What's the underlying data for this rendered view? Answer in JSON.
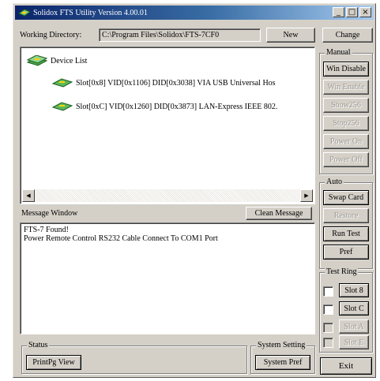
{
  "window": {
    "title": "Solidox FTS Utility Version 4.00.01",
    "controls": {
      "minimize": "_",
      "maximize": "□",
      "close": "×"
    }
  },
  "working_dir": {
    "label": "Working Directory:",
    "value": "C:\\Program Files\\Solidox\\FTS-7CF0",
    "new_label": "New",
    "change_label": "Change"
  },
  "device_tree": {
    "root": "Device List",
    "items": [
      "Slot[0x8] VID[0x1106] DID[0x3038] VIA USB Universal Hos",
      "Slot[0xC] VID[0x1260] DID[0x3873] LAN-Express IEEE 802."
    ],
    "scroll_left": "◀",
    "scroll_right": "▶"
  },
  "message_window": {
    "label": "Message Window",
    "clean_label": "Clean Message",
    "lines": [
      "FTS-7 Found!",
      "Power Remote Control RS232 Cable Connect To COM1 Port"
    ]
  },
  "manual": {
    "label": "Manual",
    "buttons": [
      {
        "label": "Win Disable",
        "enabled": true
      },
      {
        "label": "Win Enable",
        "enabled": false
      },
      {
        "label": "Show256",
        "enabled": false
      },
      {
        "label": "Stop256",
        "enabled": false
      },
      {
        "label": "Power On",
        "enabled": false
      },
      {
        "label": "Power Off",
        "enabled": false
      }
    ]
  },
  "auto": {
    "label": "Auto",
    "buttons": [
      {
        "label": "Swap Card",
        "enabled": true
      },
      {
        "label": "Restore",
        "enabled": false
      },
      {
        "label": "Run Test",
        "enabled": true
      },
      {
        "label": "Pref",
        "enabled": true
      }
    ]
  },
  "test_ring": {
    "label": "Test Ring",
    "slots": [
      {
        "label": "Slot 8",
        "enabled": true
      },
      {
        "label": "Slot C",
        "enabled": true
      },
      {
        "label": "Slot A",
        "enabled": false
      },
      {
        "label": "Slot E",
        "enabled": false
      }
    ]
  },
  "status": {
    "label": "Status",
    "printview_label": "PrintPg View"
  },
  "system_setting": {
    "label": "System Setting",
    "button_label": "System Pref"
  },
  "exit_label": "Exit"
}
